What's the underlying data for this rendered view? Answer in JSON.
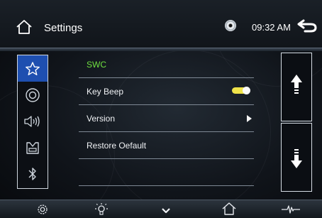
{
  "header": {
    "title": "Settings",
    "time": "09:32 AM",
    "icons": [
      "home-icon",
      "disc-icon",
      "back-icon"
    ]
  },
  "rail": {
    "tabs": [
      {
        "icon": "star-icon",
        "selected": true
      },
      {
        "icon": "disc-icon",
        "selected": false
      },
      {
        "icon": "speaker-icon",
        "selected": false
      },
      {
        "icon": "car-seat-icon",
        "selected": false
      },
      {
        "icon": "bluetooth-icon",
        "selected": false
      }
    ]
  },
  "settings": {
    "items": [
      {
        "label": "SWC",
        "highlighted": true
      },
      {
        "label": "Key Beep",
        "toggle": true
      },
      {
        "label": "Version",
        "has_chevron": true
      },
      {
        "label": "Restore Oefault"
      },
      {
        "label": ""
      }
    ]
  },
  "pager": {
    "up_icon": "page-up-icon",
    "down_icon": "page-down-icon"
  },
  "bottom_bar": {
    "icons": [
      "gear-icon",
      "brightness-icon",
      "chevron-down-icon",
      "home-icon",
      "waveform-icon"
    ]
  },
  "colors": {
    "accent_tab": "#1e4fb0",
    "highlight_text": "#6fe040",
    "toggle_on": "#efe34a"
  }
}
